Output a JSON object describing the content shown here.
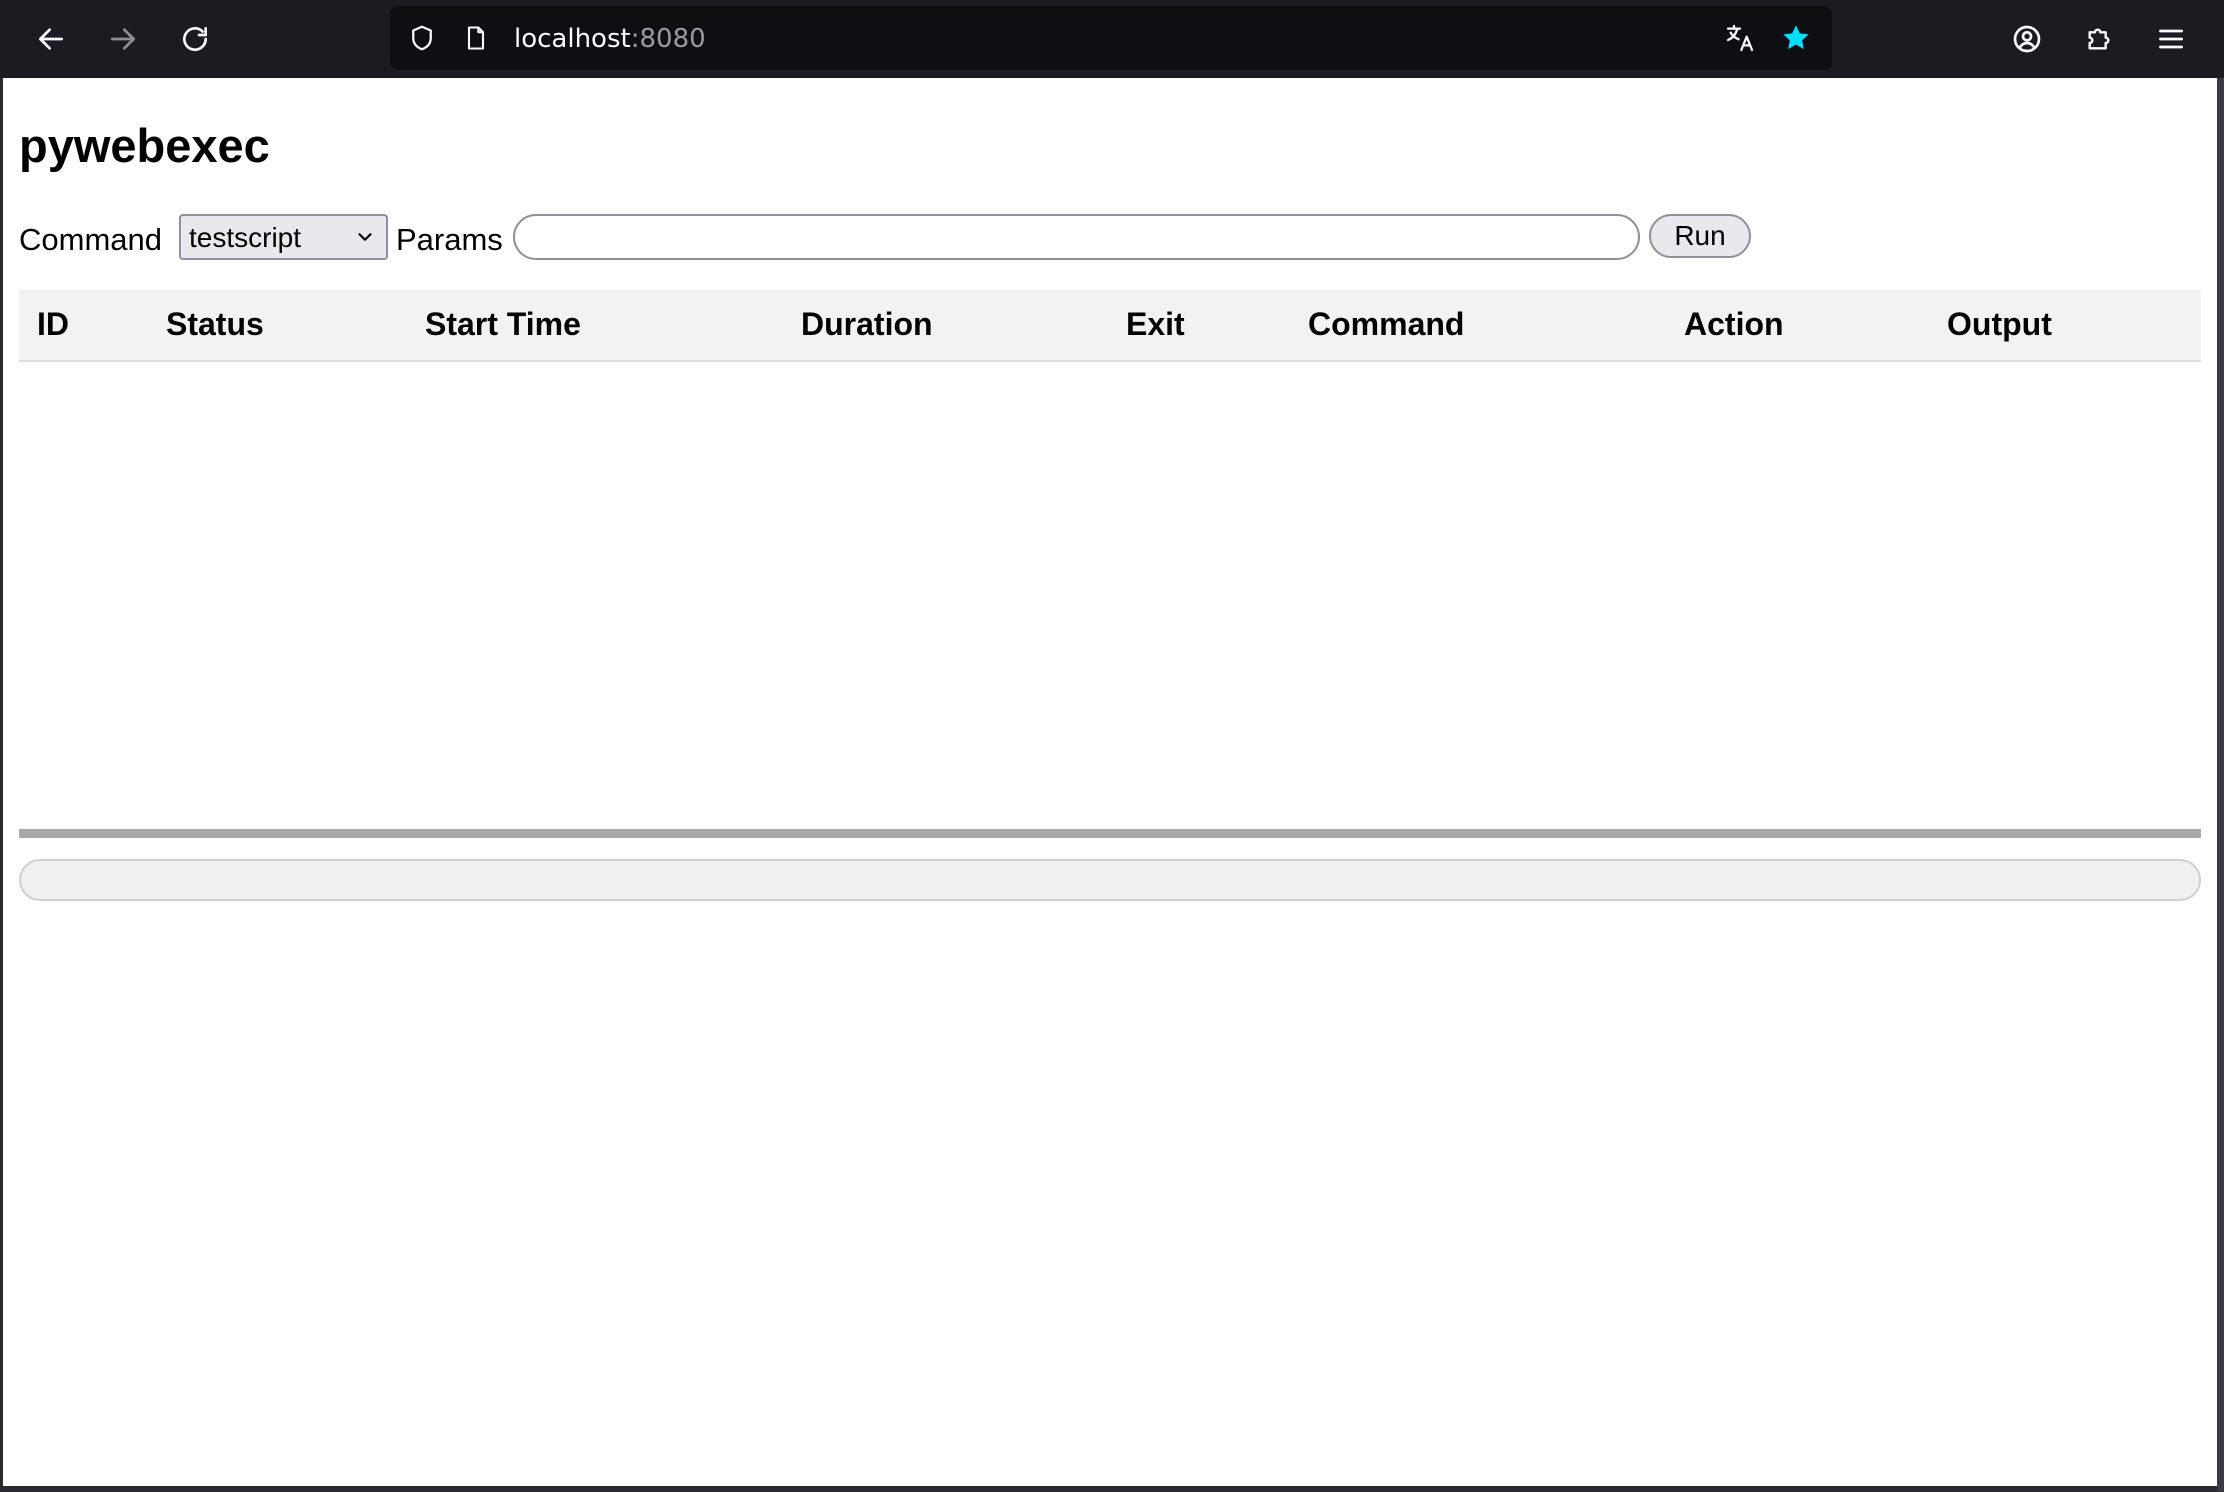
{
  "browser": {
    "url_host": "localhost",
    "url_port": ":8080"
  },
  "page": {
    "title": "pywebexec"
  },
  "form": {
    "command_label": "Command",
    "command_selected": "testscript",
    "params_label": "Params",
    "params_value": "",
    "run_label": "Run"
  },
  "table": {
    "columns": [
      "ID",
      "Status",
      "Start Time",
      "Duration",
      "Exit",
      "Command",
      "Action",
      "Output"
    ],
    "rows": []
  },
  "colors": {
    "bookmark_star": "#00ddff",
    "chrome_bg": "#1c1b22"
  }
}
